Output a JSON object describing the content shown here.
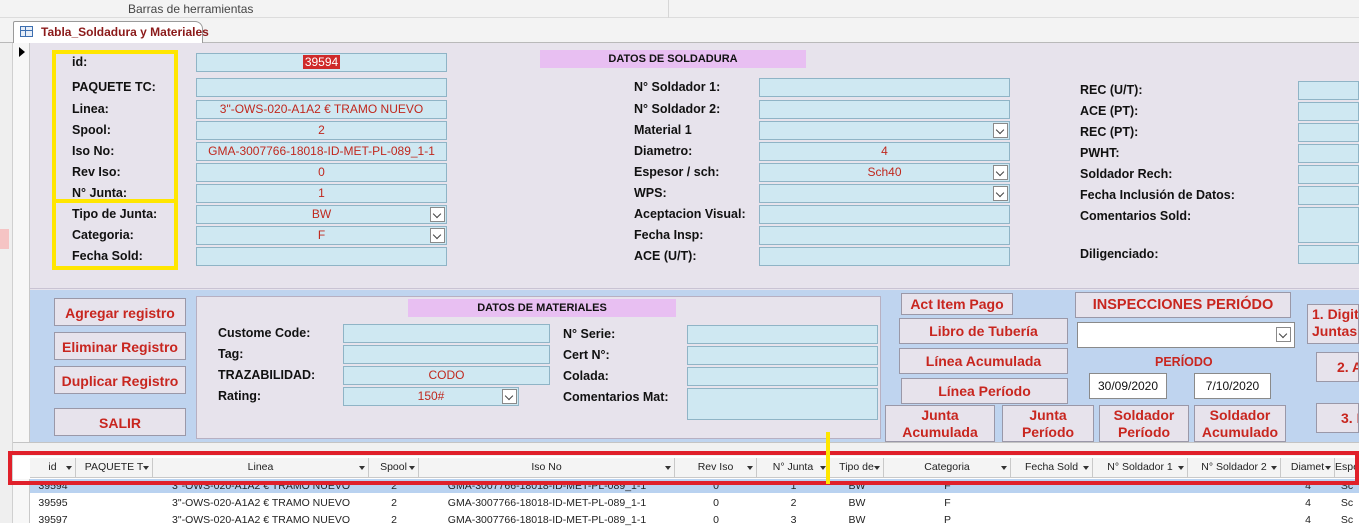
{
  "toolbar": {
    "label": "Barras de herramientas"
  },
  "document_tab": {
    "label": "Tabla_Soldadura y Materiales"
  },
  "form": {
    "id_label": "id:",
    "id_value": "39594",
    "paquete_label": "PAQUETE TC:",
    "paquete_value": "",
    "linea_label": "Linea:",
    "linea_value": "3\"-OWS-020-A1A2 € TRAMO NUEVO",
    "spool_label": "Spool:",
    "spool_value": "2",
    "iso_label": "Iso No:",
    "iso_value": "GMA-3007766-18018-ID-MET-PL-089_1-1",
    "rev_label": "Rev Iso:",
    "rev_value": "0",
    "junta_label": "N° Junta:",
    "junta_value": "1",
    "tipo_label": "Tipo de Junta:",
    "tipo_value": "BW",
    "categoria_label": "Categoria:",
    "categoria_value": "F",
    "fecha_sold_label": "Fecha Sold:",
    "fecha_sold_value": ""
  },
  "soldadura": {
    "header": "DATOS DE SOLDADURA",
    "soldador1_label": "N° Soldador 1:",
    "soldador2_label": "N° Soldador 2:",
    "material_label": "Material 1",
    "diametro_label": "Diametro:",
    "diametro_value": "4",
    "espesor_label": "Espesor / sch:",
    "espesor_value": "Sch40",
    "wps_label": "WPS:",
    "aceptacion_label": "Aceptacion Visual:",
    "fecha_insp_label": "Fecha Insp:",
    "ace_ut_label": "ACE (U/T):"
  },
  "right_col": {
    "rec_ut_label": "REC (U/T):",
    "ace_pt_label": "ACE (PT):",
    "rec_pt_label": "REC (PT):",
    "pwht_label": "PWHT:",
    "soldador_rech_label": "Soldador Rech:",
    "fecha_inclusion_label": "Fecha Inclusión de Datos:",
    "comentarios_sold_label": "Comentarios Sold:",
    "diligenciado_label": "Diligenciado:"
  },
  "buttons": {
    "agregar": "Agregar registro",
    "eliminar": "Eliminar Registro",
    "duplicar": "Duplicar Registro",
    "salir": "SALIR",
    "act_item_pago": "Act Item Pago",
    "libro_tuberia": "Libro de Tubería",
    "linea_acumulada": "Línea Acumulada",
    "linea_periodo": "Línea Período",
    "junta_acumulada_1": "Junta",
    "junta_acumulada_2": "Acumulada",
    "junta_periodo_1": "Junta",
    "junta_periodo_2": "Período",
    "soldador_periodo_1": "Soldador",
    "soldador_periodo_2": "Período",
    "soldador_acumulado_1": "Soldador",
    "soldador_acumulado_2": "Acumulado",
    "inspecciones_periodo": "INSPECCIONES PERIÓDO",
    "digit_1": "1. Digit",
    "digit_2": "Juntas",
    "btn_2a": "2. A",
    "btn_3": "3. I"
  },
  "materiales": {
    "header": "DATOS DE MATERIALES",
    "custome_code_label": "Custome Code:",
    "tag_label": "Tag:",
    "trazabilidad_label": "TRAZABILIDAD:",
    "trazabilidad_value": "CODO",
    "rating_label": "Rating:",
    "rating_value": "150#",
    "serie_label": "N° Serie:",
    "cert_label": "Cert N°:",
    "colada_label": "Colada:",
    "comentarios_mat_label": "Comentarios Mat:"
  },
  "periodo": {
    "label": "PERÍODO",
    "start": "30/09/2020",
    "end": "7/10/2020"
  },
  "grid": {
    "columns": [
      "id",
      "PAQUETE T",
      "Linea",
      "Spool",
      "Iso No",
      "Rev Iso",
      "N° Junta",
      "Tipo de",
      "Categoria",
      "Fecha Sold",
      "N° Soldador 1",
      "N° Soldador 2",
      "Diamet",
      "Espe"
    ],
    "rows": [
      [
        "39594",
        "",
        "3\"-OWS-020-A1A2 € TRAMO NUEVO",
        "2",
        "GMA-3007766-18018-ID-MET-PL-089_1-1",
        "0",
        "1",
        "BW",
        "F",
        "",
        "",
        "",
        "4",
        "Sc"
      ],
      [
        "39595",
        "",
        "3\"-OWS-020-A1A2 € TRAMO NUEVO",
        "2",
        "GMA-3007766-18018-ID-MET-PL-089_1-1",
        "0",
        "2",
        "BW",
        "F",
        "",
        "",
        "",
        "4",
        "Sc"
      ],
      [
        "39597",
        "",
        "3\"-OWS-020-A1A2 € TRAMO NUEVO",
        "2",
        "GMA-3007766-18018-ID-MET-PL-089_1-1",
        "0",
        "3",
        "BW",
        "P",
        "",
        "",
        "",
        "4",
        "Sc"
      ]
    ]
  },
  "annotation_colors": {
    "yellow": "#ffe600",
    "red": "#e0202a"
  }
}
